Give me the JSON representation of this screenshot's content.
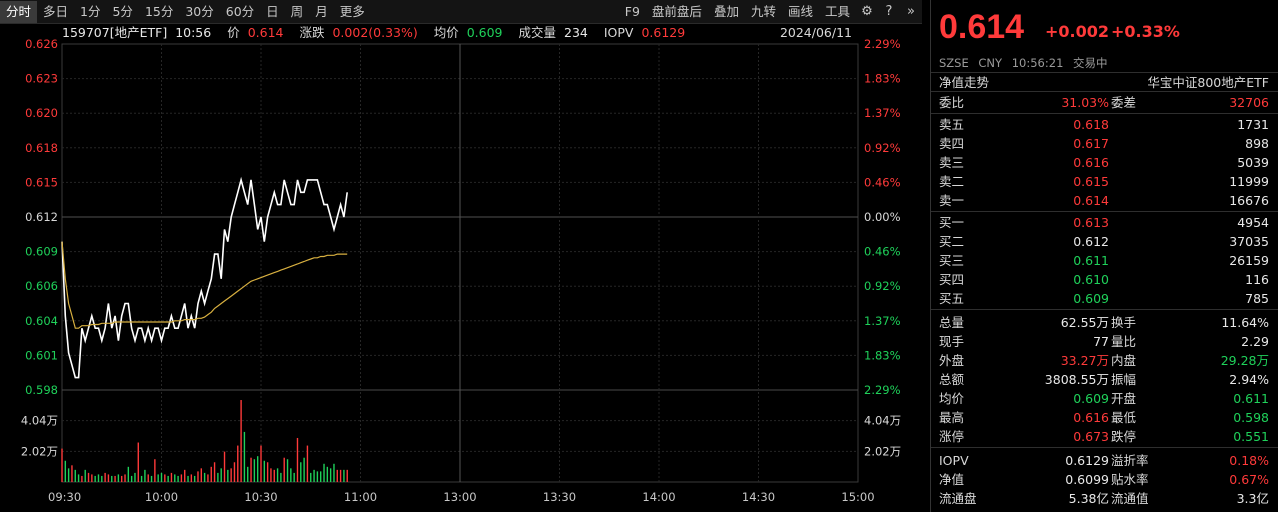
{
  "toolbar": {
    "periods": [
      "分时",
      "多日",
      "1分",
      "5分",
      "15分",
      "30分",
      "60分",
      "日",
      "周",
      "月",
      "更多"
    ],
    "active": "分时",
    "tools": [
      "F9",
      "盘前盘后",
      "叠加",
      "九转",
      "画线",
      "工具"
    ]
  },
  "info": {
    "code_name": "159707[地产ETF]",
    "time": "10:56",
    "price_label": "价",
    "price": "0.614",
    "change_label": "涨跌",
    "change": "0.002(0.33%)",
    "avg_label": "均价",
    "avg": "0.609",
    "volume_label": "成交量",
    "volume": "234",
    "iopv_label": "IOPV",
    "iopv": "0.6129",
    "date": "2024/06/11"
  },
  "axes": {
    "price_ticks": [
      "0.626",
      "0.623",
      "0.620",
      "0.618",
      "0.615",
      "0.612",
      "0.609",
      "0.606",
      "0.604",
      "0.601",
      "0.598"
    ],
    "pct_ticks": [
      "2.29%",
      "1.83%",
      "1.37%",
      "0.92%",
      "0.46%",
      "0.00%",
      "0.46%",
      "0.92%",
      "1.37%",
      "1.83%",
      "2.29%"
    ],
    "volume_ticks": [
      "4.04万",
      "2.02万"
    ],
    "time_ticks": [
      "09:30",
      "10:00",
      "10:30",
      "11:00",
      "13:00",
      "13:30",
      "14:00",
      "14:30",
      "15:00"
    ]
  },
  "chart_data": {
    "type": "line",
    "title": "",
    "xlabel": "",
    "ylabel": "",
    "ylim": [
      0.598,
      0.626
    ],
    "prev_close": 0.612,
    "x_minutes": [
      0,
      1,
      2,
      3,
      4,
      5,
      6,
      7,
      8,
      9,
      10,
      11,
      12,
      13,
      14,
      15,
      16,
      17,
      18,
      19,
      20,
      21,
      22,
      23,
      24,
      25,
      26,
      27,
      28,
      29,
      30,
      31,
      32,
      33,
      34,
      35,
      36,
      37,
      38,
      39,
      40,
      41,
      42,
      43,
      44,
      45,
      46,
      47,
      48,
      49,
      50,
      51,
      52,
      53,
      54,
      55,
      56,
      57,
      58,
      59,
      60,
      61,
      62,
      63,
      64,
      65,
      66,
      67,
      68,
      69,
      70,
      71,
      72,
      73,
      74,
      75,
      76,
      77,
      78,
      79,
      80,
      81,
      82,
      83,
      84,
      85,
      86
    ],
    "series": [
      {
        "name": "",
        "color": "#ffffff",
        "values": [
          0.61,
          0.604,
          0.601,
          0.6,
          0.599,
          0.599,
          0.603,
          0.602,
          0.603,
          0.604,
          0.603,
          0.603,
          0.602,
          0.603,
          0.605,
          0.603,
          0.604,
          0.602,
          0.604,
          0.605,
          0.605,
          0.603,
          0.602,
          0.603,
          0.603,
          0.602,
          0.603,
          0.602,
          0.603,
          0.603,
          0.602,
          0.603,
          0.603,
          0.604,
          0.603,
          0.603,
          0.604,
          0.605,
          0.603,
          0.604,
          0.603,
          0.605,
          0.606,
          0.605,
          0.606,
          0.607,
          0.609,
          0.609,
          0.607,
          0.611,
          0.61,
          0.612,
          0.613,
          0.614,
          0.615,
          0.614,
          0.613,
          0.615,
          0.613,
          0.611,
          0.612,
          0.61,
          0.612,
          0.613,
          0.614,
          0.613,
          0.613,
          0.615,
          0.614,
          0.613,
          0.613,
          0.615,
          0.614,
          0.614,
          0.615,
          0.615,
          0.615,
          0.615,
          0.614,
          0.613,
          0.613,
          0.612,
          0.611,
          0.612,
          0.613,
          0.612,
          0.614
        ]
      },
      {
        "name": "",
        "color": "#d8b040",
        "values": [
          0.61,
          0.607,
          0.605,
          0.604,
          0.603,
          0.603,
          0.6032,
          0.6032,
          0.6032,
          0.6033,
          0.6033,
          0.6033,
          0.6034,
          0.6034,
          0.6034,
          0.6034,
          0.6035,
          0.6035,
          0.6035,
          0.6035,
          0.6035,
          0.6035,
          0.6035,
          0.6035,
          0.6035,
          0.6035,
          0.6035,
          0.6035,
          0.6035,
          0.6035,
          0.6035,
          0.6035,
          0.6035,
          0.6035,
          0.6036,
          0.6036,
          0.6036,
          0.6037,
          0.6037,
          0.6037,
          0.6037,
          0.6038,
          0.6038,
          0.6039,
          0.6041,
          0.6043,
          0.6046,
          0.6048,
          0.605,
          0.6052,
          0.6054,
          0.6056,
          0.6058,
          0.606,
          0.6062,
          0.6064,
          0.6066,
          0.6068,
          0.6069,
          0.607,
          0.6071,
          0.6072,
          0.6073,
          0.6074,
          0.6075,
          0.6076,
          0.6077,
          0.6078,
          0.6079,
          0.608,
          0.6081,
          0.6082,
          0.6083,
          0.6084,
          0.6085,
          0.6086,
          0.6087,
          0.6087,
          0.6088,
          0.6088,
          0.6089,
          0.6089,
          0.6089,
          0.609,
          0.609,
          0.609,
          0.609
        ]
      }
    ],
    "volume": [
      2.2,
      1.4,
      0.9,
      1.1,
      0.8,
      0.5,
      0.4,
      0.8,
      0.6,
      0.5,
      0.4,
      0.5,
      0.4,
      0.6,
      0.5,
      0.4,
      0.4,
      0.5,
      0.4,
      0.5,
      1.0,
      0.4,
      0.6,
      2.6,
      0.4,
      0.8,
      0.5,
      0.4,
      1.5,
      0.5,
      0.6,
      0.5,
      0.4,
      0.6,
      0.5,
      0.4,
      0.5,
      0.8,
      0.4,
      0.5,
      0.4,
      0.7,
      0.9,
      0.6,
      0.5,
      1.0,
      1.3,
      0.6,
      0.9,
      2.0,
      0.8,
      0.9,
      1.3,
      2.4,
      5.4,
      3.3,
      1.0,
      1.6,
      1.5,
      1.7,
      2.4,
      1.4,
      1.3,
      0.9,
      0.8,
      0.9,
      0.6,
      1.6,
      1.5,
      0.9,
      0.6,
      2.9,
      1.3,
      1.6,
      2.4,
      0.6,
      0.8,
      0.7,
      0.7,
      1.2,
      1.0,
      0.9,
      1.2,
      0.8,
      0.8,
      0.8,
      0.8
    ],
    "volume_up": [
      1,
      0,
      0,
      1,
      0,
      0,
      1,
      0,
      1,
      1,
      0,
      0,
      0,
      1,
      1,
      0,
      1,
      0,
      1,
      1,
      0,
      0,
      0,
      1,
      0,
      0,
      1,
      0,
      1,
      0,
      0,
      1,
      0,
      1,
      0,
      0,
      1,
      1,
      0,
      1,
      0,
      1,
      1,
      0,
      1,
      1,
      1,
      0,
      0,
      1,
      0,
      1,
      1,
      1,
      1,
      0,
      0,
      1,
      0,
      0,
      1,
      0,
      1,
      1,
      1,
      0,
      0,
      1,
      0,
      0,
      0,
      1,
      0,
      0,
      1,
      0,
      0,
      0,
      0,
      0,
      0,
      0,
      0,
      1,
      1,
      0,
      1
    ],
    "volume_ylim": [
      0,
      6.06
    ]
  },
  "panel": {
    "price": "0.614",
    "change": "+0.002",
    "pct": "+0.33%",
    "meta": [
      "SZSE",
      "CNY",
      "10:56:21",
      "交易中"
    ],
    "nav_left": "净值走势",
    "nav_right": "华宝中证800地产ETF",
    "ratio_label": "委比",
    "ratio": "31.03%",
    "diff_label": "委差",
    "diff": "32706",
    "asks": [
      {
        "label": "卖五",
        "price": "0.618",
        "vol": "1731"
      },
      {
        "label": "卖四",
        "price": "0.617",
        "vol": "898"
      },
      {
        "label": "卖三",
        "price": "0.616",
        "vol": "5039"
      },
      {
        "label": "卖二",
        "price": "0.615",
        "vol": "11999"
      },
      {
        "label": "卖一",
        "price": "0.614",
        "vol": "16676"
      }
    ],
    "bids": [
      {
        "label": "买一",
        "price": "0.613",
        "vol": "4954"
      },
      {
        "label": "买二",
        "price": "0.612",
        "vol": "37035"
      },
      {
        "label": "买三",
        "price": "0.611",
        "vol": "26159"
      },
      {
        "label": "买四",
        "price": "0.610",
        "vol": "116"
      },
      {
        "label": "买五",
        "price": "0.609",
        "vol": "785"
      }
    ],
    "stats": [
      [
        "总量",
        "62.55万",
        "换手",
        "11.64%"
      ],
      [
        "现手",
        "77",
        "量比",
        "2.29"
      ],
      [
        "外盘",
        "33.27万",
        "内盘",
        "29.28万"
      ],
      [
        "总额",
        "3808.55万",
        "振幅",
        "2.94%"
      ],
      [
        "均价",
        "0.609",
        "开盘",
        "0.611"
      ],
      [
        "最高",
        "0.616",
        "最低",
        "0.598"
      ],
      [
        "涨停",
        "0.673",
        "跌停",
        "0.551"
      ]
    ],
    "stats_colors": [
      [
        "white",
        "white"
      ],
      [
        "white",
        "white"
      ],
      [
        "red",
        "green"
      ],
      [
        "white",
        "white"
      ],
      [
        "green",
        "green"
      ],
      [
        "red",
        "green"
      ],
      [
        "red",
        "green"
      ]
    ],
    "fund": [
      [
        "IOPV",
        "0.6129",
        "溢折率",
        "0.18%"
      ],
      [
        "净值",
        "0.6099",
        "贴水率",
        "0.67%"
      ],
      [
        "流通盘",
        "5.38亿",
        "流通值",
        "3.3亿"
      ]
    ],
    "fund_colors": [
      [
        "white",
        "red"
      ],
      [
        "white",
        "red"
      ],
      [
        "white",
        "white"
      ]
    ]
  }
}
